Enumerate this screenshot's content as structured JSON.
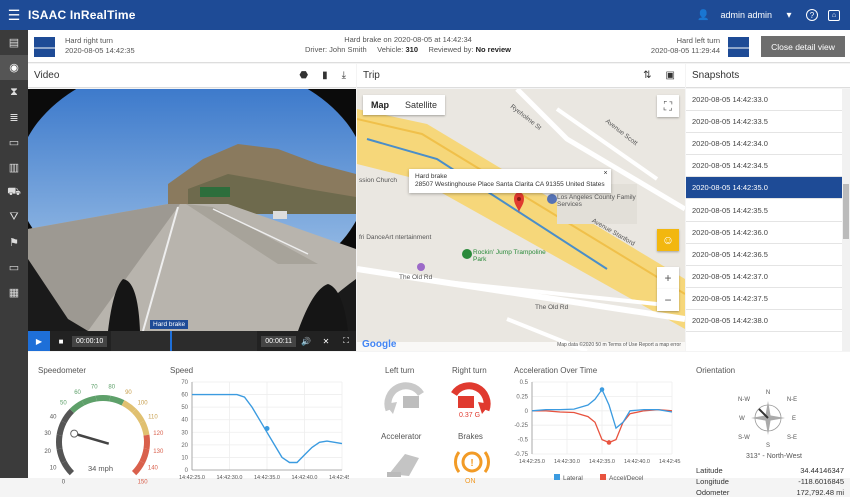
{
  "app": {
    "title": "ISAAC InRealTime",
    "user": "admin admin"
  },
  "sidebar": {
    "items": [
      "dashboard-icon",
      "eye-icon",
      "hourglass-icon",
      "list-icon",
      "document-icon",
      "chart-icon",
      "truck-icon",
      "road-icon",
      "route-icon",
      "monitor-icon",
      "report-icon"
    ]
  },
  "event": {
    "prev_title": "Hard right turn",
    "prev_time": "2020-08-05 14:42:35",
    "next_title": "Hard left turn",
    "next_time": "2020-08-05 11:29:44",
    "title": "Hard brake on 2020-08-05 at 14:42:34",
    "driver_label": "Driver:",
    "driver": "John Smith",
    "vehicle_label": "Vehicle:",
    "vehicle": "310",
    "reviewed_label": "Reviewed by:",
    "reviewed": "No review",
    "close_label": "Close detail view"
  },
  "video": {
    "title": "Video",
    "event_label": "Hard brake",
    "time_start": "00:00:10",
    "time_end": "00:00:11"
  },
  "trip": {
    "title": "Trip",
    "tab_map": "Map",
    "tab_satellite": "Satellite",
    "popup_title": "Hard brake",
    "popup_address": "28507 Westinghouse Place Santa Clarita CA 91355 United States",
    "labels": {
      "church": "ssion Church",
      "la_county": "Los Angeles County Family Services",
      "danceart": "fri DanceArt ntertainment",
      "rockin": "Rockin' Jump Trampoline Park",
      "old_rd": "The Old Rd",
      "old_rd2": "The Old Rd",
      "avenue_stanford": "Avenue Stanford",
      "ryeholme": "Ryeholme St",
      "avenue_scott": "Avenue Scott"
    },
    "footer": "Map data ©2020   50 m   Terms of Use   Report a map error",
    "google": "Google"
  },
  "snapshots": {
    "title": "Snapshots",
    "items": [
      "2020-08-05 14:42:33.0",
      "2020-08-05 14:42:33.5",
      "2020-08-05 14:42:34.0",
      "2020-08-05 14:42:34.5",
      "2020-08-05 14:42:35.0",
      "2020-08-05 14:42:35.5",
      "2020-08-05 14:42:36.0",
      "2020-08-05 14:42:36.5",
      "2020-08-05 14:42:37.0",
      "2020-08-05 14:42:37.5",
      "2020-08-05 14:42:38.0"
    ],
    "selected_index": 4
  },
  "speedometer": {
    "title": "Speedometer",
    "value_label": "34 mph",
    "value": 34,
    "ticks": [
      "0",
      "10",
      "20",
      "30",
      "40",
      "50",
      "60",
      "70",
      "80",
      "90",
      "100",
      "110",
      "120",
      "130",
      "140",
      "150"
    ]
  },
  "speed_chart": {
    "title": "Speed",
    "y_ticks": [
      "70",
      "60",
      "50",
      "40",
      "30",
      "20",
      "10",
      "0"
    ],
    "x_ticks": [
      "14:42:25.0",
      "14:42:30.0",
      "14:42:35.0",
      "14:42:40.0",
      "14:42:45.0"
    ]
  },
  "turns": {
    "left_turn": "Left turn",
    "right_turn": "Right turn",
    "right_turn_value": "0.37 G",
    "accelerator": "Accelerator",
    "brakes": "Brakes",
    "brakes_value": "ON"
  },
  "accel_chart": {
    "title": "Acceleration Over Time",
    "y_ticks": [
      "0.5",
      "0.25",
      "0",
      "-0.25",
      "-0.5",
      "-0.75"
    ],
    "x_ticks": [
      "14:42:25.0",
      "14:42:30.0",
      "14:42:35.0",
      "14:42:40.0",
      "14:42:45.0"
    ],
    "legend_lateral": "Lateral",
    "legend_accel": "Accel/Decel",
    "color_lateral": "#3b9be0",
    "color_accel": "#e8533f"
  },
  "orientation": {
    "title": "Orientation",
    "heading": "313° - North-West",
    "dirs": {
      "n": "N",
      "ne": "N-E",
      "e": "E",
      "se": "S-E",
      "s": "S",
      "sw": "S-W",
      "w": "W",
      "nw": "N-W"
    },
    "latitude_label": "Latitude",
    "latitude": "34.44146347",
    "longitude_label": "Longitude",
    "longitude": "-118.6016845",
    "odometer_label": "Odometer",
    "odometer": "172,792.48 mi"
  }
}
